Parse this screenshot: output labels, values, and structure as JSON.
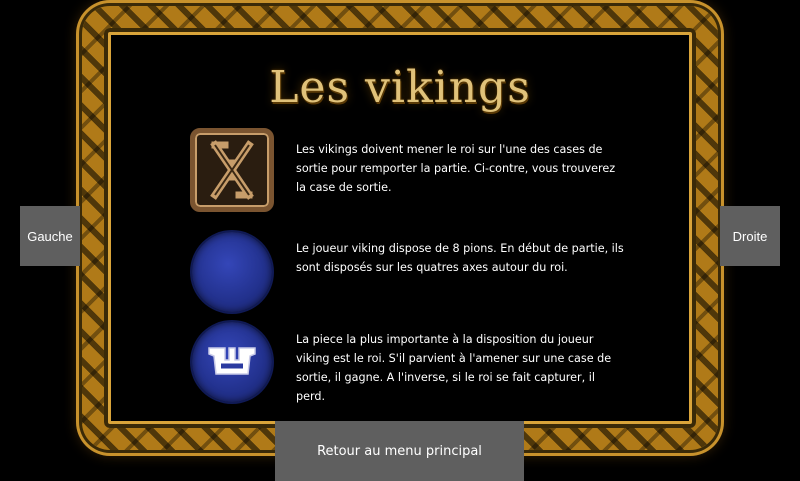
{
  "title": "Les vikings",
  "sections": [
    {
      "icon": "exit-square-icon",
      "text": "Les vikings doivent mener le roi sur l'une des cases de sortie pour remporter la partie. Ci-contre, vous trouverez la case de sortie."
    },
    {
      "icon": "viking-pawn-icon",
      "text": "Le joueur viking dispose de 8 pions.  En début de partie, ils sont disposés sur les quatres axes autour du roi."
    },
    {
      "icon": "viking-king-icon",
      "text": "La piece la plus importante à la disposition du joueur viking est le roi. S'il parvient à l'amener sur une case de sortie, il gagne. A l'inverse, si le roi se fait capturer, il perd."
    }
  ],
  "nav": {
    "left_label": "Gauche",
    "right_label": "Droite",
    "back_label": "Retour au menu principal"
  },
  "colors": {
    "frame_gold": "#b07a18",
    "title_gold": "#e0c27a",
    "pawn_blue": "#2a3aa0",
    "button_gray": "#5f5f5f"
  }
}
